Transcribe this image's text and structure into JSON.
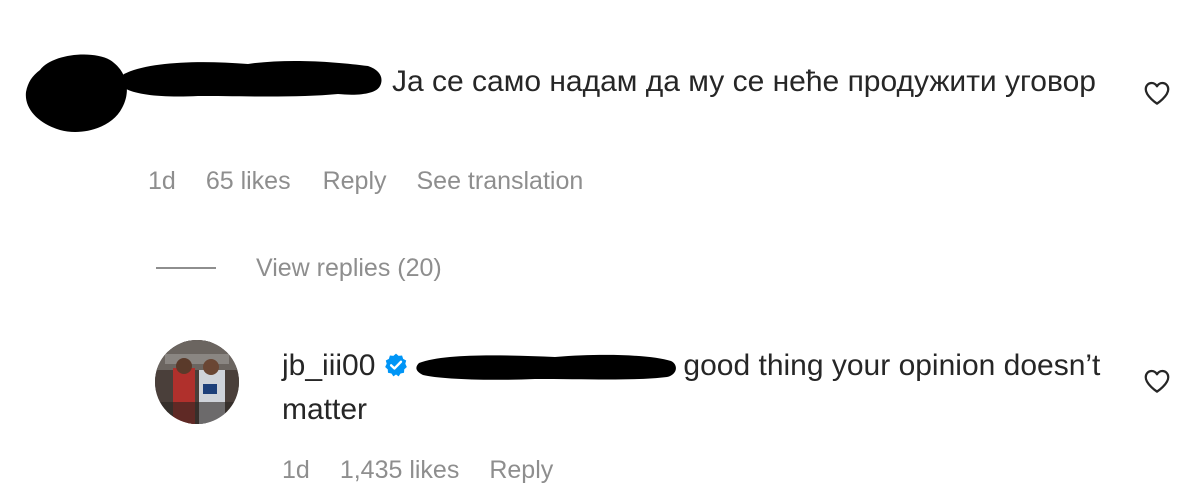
{
  "comment_main": {
    "text": "Ја се само надам да му се неће продужити уговор",
    "time": "1d",
    "likes": "65 likes",
    "reply_label": "Reply",
    "translate_label": "See translation",
    "view_replies_label": "View replies (20)"
  },
  "comment_reply": {
    "username": "jb_iii00",
    "text": "good thing your opinion doesn’t matter",
    "time": "1d",
    "likes": "1,435 likes",
    "reply_label": "Reply"
  },
  "colors": {
    "text": "#262626",
    "secondary": "#8e8e8e",
    "verified": "#0095f6",
    "redaction": "#000000"
  },
  "icons": {
    "like": "heart-outline-icon",
    "verified": "verified-badge-icon"
  }
}
